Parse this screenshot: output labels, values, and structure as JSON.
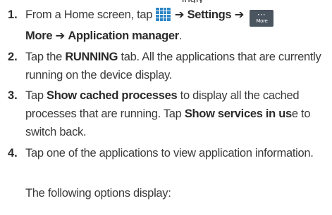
{
  "cutoff_text": "ingly",
  "steps": [
    {
      "number": "1.",
      "line1_prefix": "From a Home screen, tap",
      "arrow1": "➔",
      "settings": "Settings",
      "arrow2": "➔",
      "more_icon_label": "More",
      "line2_more": "More",
      "arrow3": "➔",
      "application_manager": "Application manager",
      "period": "."
    },
    {
      "number": "2.",
      "prefix": "Tap the ",
      "bold": "RUNNING",
      "suffix": " tab. All the applications that are currently running on the device display."
    },
    {
      "number": "3.",
      "prefix": "Tap ",
      "bold1": "Show cached processes",
      "middle": " to display all the cached processes that are running. Tap ",
      "bold2": "Show services in us",
      "suffix": "e to switch back."
    },
    {
      "number": "4.",
      "text": "Tap one of the applications to view application information."
    }
  ],
  "following": "The following options display:",
  "colors": {
    "text": "#3a3a3a",
    "apps_icon": "#2e86c4",
    "more_icon": "#4a5560"
  },
  "icons": [
    "apps-grid-icon",
    "more-icon"
  ]
}
